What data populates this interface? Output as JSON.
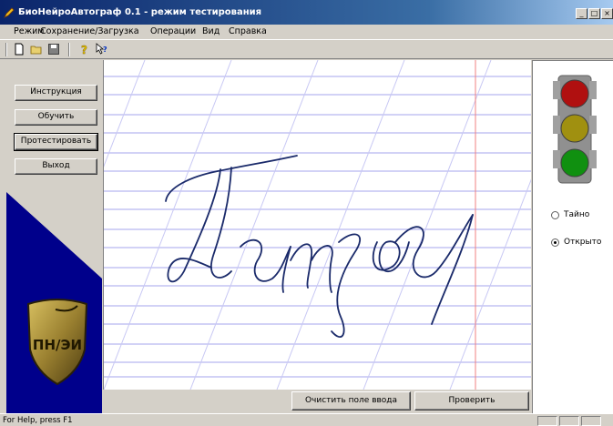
{
  "window": {
    "title": "БиоНейроАвтограф 0.1 - режим тестирования",
    "controls": [
      "_",
      "□",
      "×"
    ]
  },
  "menu": [
    "Режим",
    "Сохранение/Загрузка",
    "Операции",
    "Вид",
    "Справка"
  ],
  "toolbar": {
    "icons": [
      "new-file-icon",
      "open-folder-icon",
      "save-disk-icon",
      "help-icon",
      "context-help-icon"
    ]
  },
  "sidebar": {
    "buttons": [
      "Инструкция",
      "Обучить",
      "Протестировать",
      "Выход"
    ],
    "logo_text": "ПН/ЭИ"
  },
  "canvas": {
    "line_color": "#b8b8f0",
    "slant_color": "#c8c8f4",
    "margin_color": "#f08080",
    "ink_color": "#1a2a6a"
  },
  "traffic_light": {
    "lamps": [
      "red",
      "yellow",
      "green"
    ],
    "colors": [
      "#b01010",
      "#a09010",
      "#109010"
    ]
  },
  "mode": {
    "options": [
      "Тайно",
      "Открыто"
    ],
    "selected": "Открыто"
  },
  "actions": {
    "clear": "Очистить поле ввода",
    "check": "Проверить"
  },
  "status": {
    "text": "For Help, press F1"
  },
  "colors": {
    "title_bar": "#0a246a",
    "panel_blue": "#00008b",
    "face": "#d4d0c8"
  }
}
